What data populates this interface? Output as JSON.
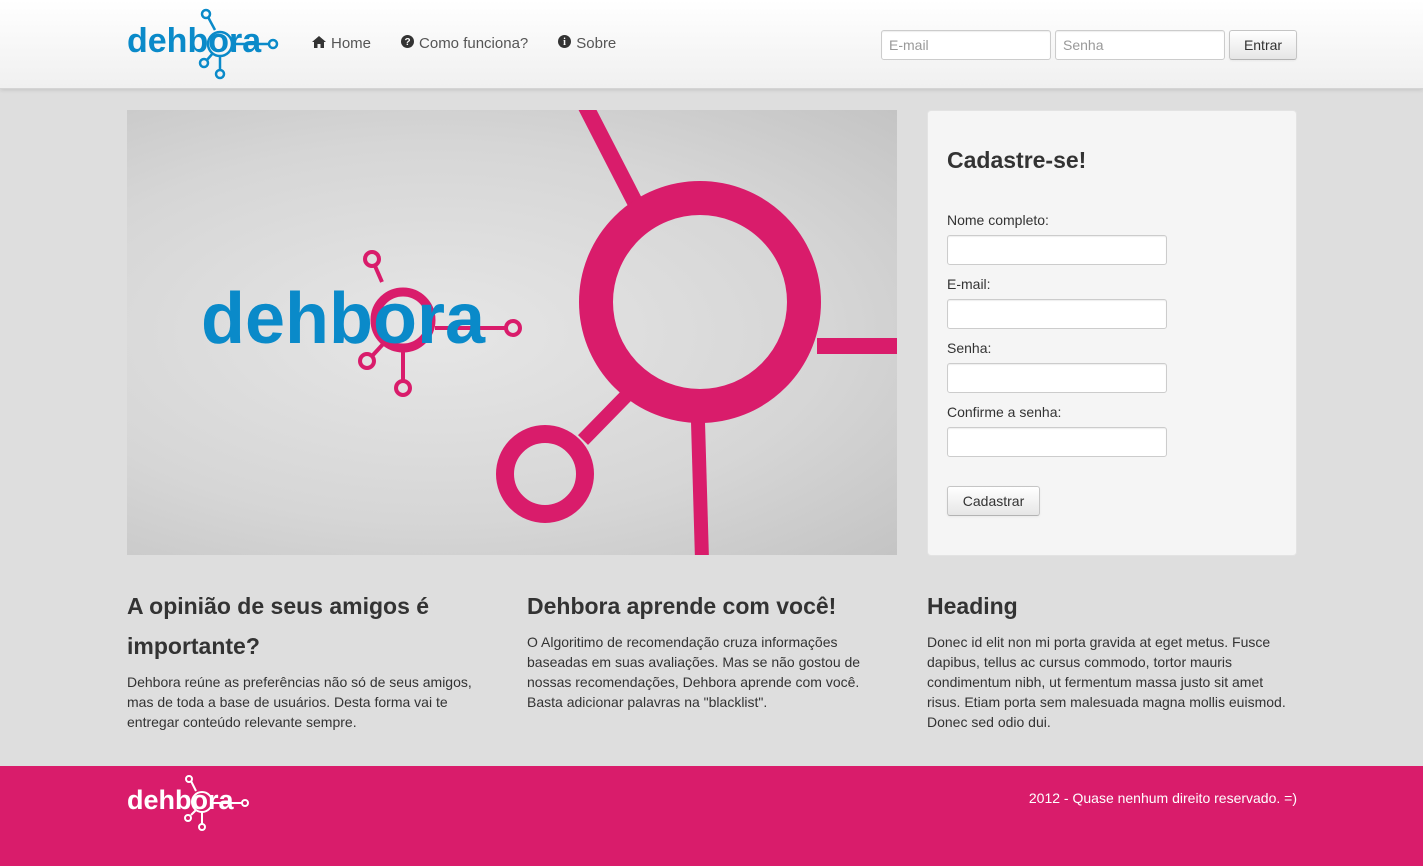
{
  "brand": {
    "logo_text": "dehbora",
    "logo_color": "#0a8ac9",
    "accent_color": "#d91c6b"
  },
  "nav": {
    "items": [
      {
        "label": "Home",
        "icon": "home-icon"
      },
      {
        "label": "Como funciona?",
        "icon": "question-circle-icon"
      },
      {
        "label": "Sobre",
        "icon": "info-circle-icon"
      }
    ]
  },
  "login": {
    "email_placeholder": "E-mail",
    "password_placeholder": "Senha",
    "submit_label": "Entrar"
  },
  "hero": {
    "logo_text": "dehbora"
  },
  "signup": {
    "title": "Cadastre-se!",
    "fields": [
      {
        "label": "Nome completo:"
      },
      {
        "label": "E-mail:"
      },
      {
        "label": "Senha:"
      },
      {
        "label": "Confirme a senha:"
      }
    ],
    "submit_label": "Cadastrar"
  },
  "columns": [
    {
      "heading": "A opinião de seus amigos é importante?",
      "text": "Dehbora reúne as preferências não só de seus amigos, mas de toda a base de usuários. Desta forma vai te entregar conteúdo relevante sempre."
    },
    {
      "heading": "Dehbora aprende com você!",
      "text": "O Algoritimo de recomendação cruza informações baseadas em suas avaliações. Mas se não gostou de nossas recomendações, Dehbora aprende com você. Basta adicionar palavras na \"blacklist\"."
    },
    {
      "heading": "Heading",
      "text": "Donec id elit non mi porta gravida at eget metus. Fusce dapibus, tellus ac cursus commodo, tortor mauris condimentum nibh, ut fermentum massa justo sit amet risus. Etiam porta sem malesuada magna mollis euismod. Donec sed odio dui."
    }
  ],
  "footer": {
    "logo_text": "dehbora",
    "copyright": "2012 - Quase nenhum direito reservado. =)"
  }
}
